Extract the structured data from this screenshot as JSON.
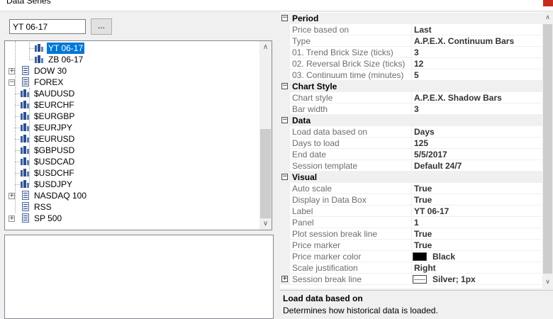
{
  "window": {
    "title": "Data Series"
  },
  "search": {
    "value": "YT 06-17"
  },
  "browse_button": {
    "label": "..."
  },
  "tree": {
    "items": [
      {
        "label": "YT 06-17",
        "level": 2,
        "kind": "symbol",
        "selected": true
      },
      {
        "label": "ZB 06-17",
        "level": 2,
        "kind": "symbol"
      },
      {
        "label": "DOW 30",
        "level": 0,
        "kind": "folder",
        "expander": "+"
      },
      {
        "label": "FOREX",
        "level": 0,
        "kind": "folder",
        "expander": "−"
      },
      {
        "label": "$AUDUSD",
        "level": 1,
        "kind": "symbol"
      },
      {
        "label": "$EURCHF",
        "level": 1,
        "kind": "symbol"
      },
      {
        "label": "$EURGBP",
        "level": 1,
        "kind": "symbol"
      },
      {
        "label": "$EURJPY",
        "level": 1,
        "kind": "symbol"
      },
      {
        "label": "$EURUSD",
        "level": 1,
        "kind": "symbol"
      },
      {
        "label": "$GBPUSD",
        "level": 1,
        "kind": "symbol"
      },
      {
        "label": "$USDCAD",
        "level": 1,
        "kind": "symbol"
      },
      {
        "label": "$USDCHF",
        "level": 1,
        "kind": "symbol"
      },
      {
        "label": "$USDJPY",
        "level": 1,
        "kind": "symbol"
      },
      {
        "label": "NASDAQ 100",
        "level": 0,
        "kind": "folder",
        "expander": "+"
      },
      {
        "label": "RSS",
        "level": 0,
        "kind": "folder"
      },
      {
        "label": "SP 500",
        "level": 0,
        "kind": "folder",
        "expander": "+"
      }
    ]
  },
  "properties": {
    "categories": [
      {
        "name": "Period",
        "rows": [
          {
            "name": "Price based on",
            "value": "Last",
            "bold": true
          },
          {
            "name": "Type",
            "value": "A.P.E.X. Continuum Bars",
            "bold": true
          },
          {
            "name": "01. Trend Brick Size (ticks)",
            "value": "3",
            "bold": true
          },
          {
            "name": "02. Reversal Brick Size (ticks)",
            "value": "12",
            "bold": true
          },
          {
            "name": "03. Continuum time (minutes)",
            "value": "5",
            "bold": true
          }
        ]
      },
      {
        "name": "Chart Style",
        "rows": [
          {
            "name": "Chart style",
            "value": "A.P.E.X. Shadow Bars",
            "bold": true
          },
          {
            "name": "Bar width",
            "value": "3",
            "bold": true
          }
        ]
      },
      {
        "name": "Data",
        "rows": [
          {
            "name": "Load data based on",
            "value": "Days",
            "bold": true,
            "selected": true
          },
          {
            "name": "Days to load",
            "value": "125",
            "bold": true
          },
          {
            "name": "End date",
            "value": "5/5/2017",
            "bold": true
          },
          {
            "name": "Session template",
            "value": "Default 24/7",
            "bold": true
          }
        ]
      },
      {
        "name": "Visual",
        "rows": [
          {
            "name": "Auto scale",
            "value": "True",
            "bold": true
          },
          {
            "name": "Display in Data Box",
            "value": "True",
            "bold": true
          },
          {
            "name": "Label",
            "value": "YT 06-17",
            "bold": true
          },
          {
            "name": "Panel",
            "value": "1",
            "bold": true
          },
          {
            "name": "Plot session break line",
            "value": "True",
            "bold": true
          },
          {
            "name": "Price marker",
            "value": "True",
            "bold": true
          },
          {
            "name": "Price marker color",
            "value": "Black",
            "bold": true,
            "swatch": "#000000"
          },
          {
            "name": "Scale justification",
            "value": "Right",
            "bold": true
          },
          {
            "name": "Session break line",
            "value": "Silver; 1px",
            "bold": true,
            "swatch_line": true,
            "expander": "+"
          }
        ]
      }
    ]
  },
  "help": {
    "title": "Load data based on",
    "description": "Determines how historical data is loaded."
  },
  "colors": {
    "selection": "#0078d7",
    "close": "#c42b1c"
  }
}
